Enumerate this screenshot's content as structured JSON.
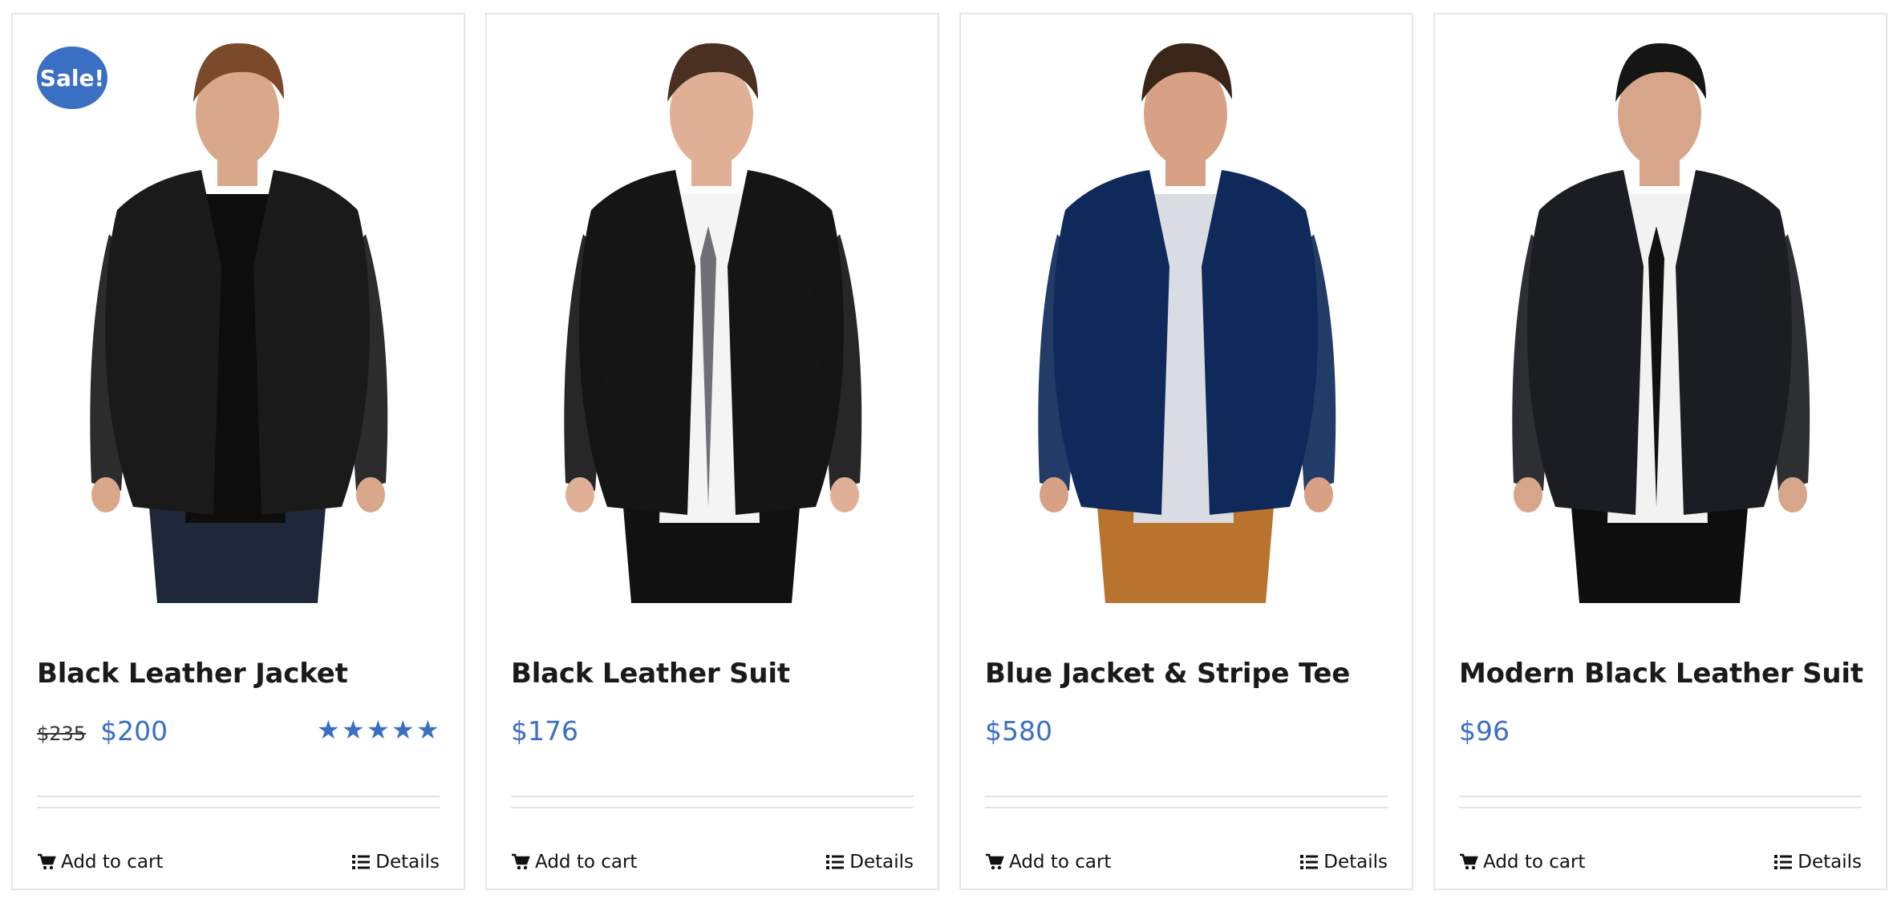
{
  "products": [
    {
      "title": "Black Leather Jacket",
      "badge": "Sale!",
      "old_price": "$235",
      "price": "$200",
      "rating": 5,
      "add_to_cart": "Add to cart",
      "details": "Details",
      "photo": {
        "jacket": "#1a1a1a",
        "shirt": "#0d0d0d",
        "pants": "#1f2838",
        "hair": "#7a4a2a",
        "skin": "#d9a88a",
        "tie": null
      }
    },
    {
      "title": "Black Leather Suit",
      "old_price": "",
      "price": "$176",
      "add_to_cart": "Add to cart",
      "details": "Details",
      "photo": {
        "jacket": "#151515",
        "shirt": "#f4f4f4",
        "pants": "#111111",
        "hair": "#4a3020",
        "skin": "#e0b096",
        "tie": "#6f6f75"
      }
    },
    {
      "title": "Blue Jacket & Stripe Tee",
      "old_price": "",
      "price": "$580",
      "add_to_cart": "Add to cart",
      "details": "Details",
      "photo": {
        "jacket": "#0f2a5a",
        "shirt": "#dadce3",
        "pants": "#b8732f",
        "hair": "#3a2618",
        "skin": "#d8a084",
        "tie": null
      }
    },
    {
      "title": "Modern Black Leather Suit",
      "old_price": "",
      "price": "$96",
      "add_to_cart": "Add to cart",
      "details": "Details",
      "photo": {
        "jacket": "#1c1d22",
        "shirt": "#f2f2f2",
        "pants": "#0e0e0e",
        "hair": "#151515",
        "skin": "#d6a58a",
        "tie": "#111111"
      }
    }
  ],
  "colors": {
    "accent": "#3a6fc4",
    "border": "#e6e6e6",
    "text": "#1a1a1a"
  },
  "icons": {
    "cart": "cart-icon",
    "details": "list-icon",
    "star": "star-icon"
  }
}
